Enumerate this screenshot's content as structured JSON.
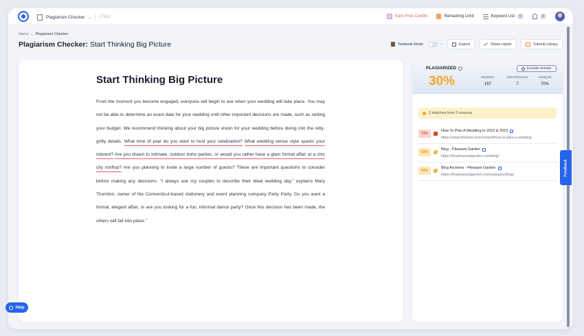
{
  "topbar": {
    "tool_name": "Plagiarism Checker",
    "words_ghost": "27651",
    "earn": "Earn Free Credits",
    "remaining": "Remaining Limit",
    "keyword_list": "Keyword List",
    "keyword_count": "0",
    "notif_count": "0"
  },
  "breadcrumb": {
    "home": "Home",
    "current": "Plagiarism Checker"
  },
  "page": {
    "title_bold": "Plagiarism Checker:",
    "title_rest": " Start Thinking Big Picture"
  },
  "actions": {
    "textbook": "Textbook Mode",
    "export": "Export",
    "share": "Share report",
    "tutorial": "Tutorial Library"
  },
  "document": {
    "title": "Start Thinking Big Picture",
    "p1": "From the moment you become engaged, everyone will begin to ask when your wedding will take place. You may not be able to determine an exact date for your wedding until other important decisions are made, such as setting your budget. We recommend thinking about your big picture vision for your wedding before diving into the nitty-gritty details. ",
    "h1": "What time of year do you want to host your celebration?",
    "sp1": " ",
    "h2": "What wedding venue style sparks your interest?",
    "sp2": " ",
    "h3": "Are you drawn to intimate, outdoor boho parties, or would you rather have a glam formal affair at a chic city rooftop?",
    "p2": " Are you planning to invite a large number of guests? These are important questions to consider before making any decisions. \"I always ask my couples to describe their ideal wedding day,\" explains Mary Thornton, owner of the Connecticut-based stationery and event planning company Party Party. Do you want a formal, elegant affair, or are you looking for a fun, informal dance party? Once this decision has been made, the others will fall into place.\""
  },
  "results": {
    "plagiarized_label": "PLAGIARIZED",
    "exclude_label": "Exclude domain",
    "percent": "30%",
    "stats": [
      {
        "label": "WORDS",
        "value": "167"
      },
      {
        "label": "SENTENCES",
        "value": "7"
      },
      {
        "label": "UNIQUE",
        "value": "70%"
      }
    ],
    "matches_banner": "3 matches from 3 sources",
    "matches": [
      {
        "percent": "74%",
        "title": "How To Plan A Wedding In 2022 & 2023",
        "url": "https://www.theknot.com/content/how-to-plan-a-wedding"
      },
      {
        "percent": "61%",
        "title": "Blog - Pleasant Garden",
        "url": "https://thepleasantgarden.com/blog/"
      },
      {
        "percent": "61%",
        "title": "Blog Archives - Pleasant Garden",
        "url": "https://thepleasantgarden.com/category/blog/"
      }
    ]
  },
  "help_label": "Help",
  "feedback_label": "Feedback",
  "colors": {
    "accent": "#2563eb",
    "score": "#f5a623",
    "highlight": "#e85f6e"
  }
}
